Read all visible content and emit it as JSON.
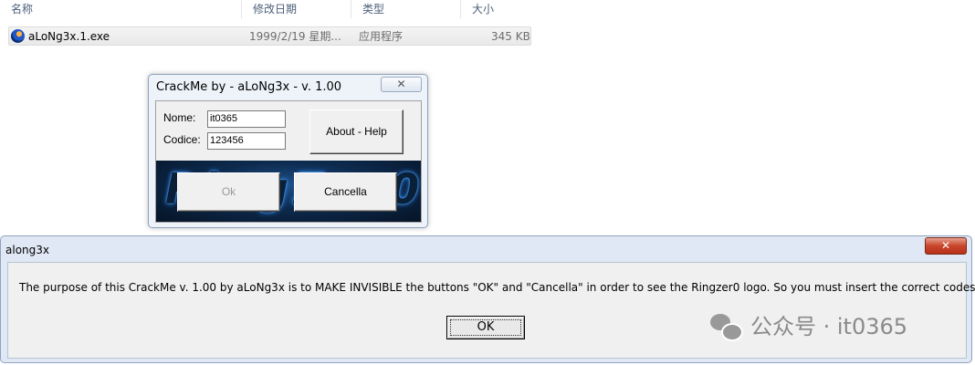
{
  "explorer": {
    "columns": [
      "名称",
      "修改日期",
      "类型",
      "大小"
    ],
    "file": {
      "name": "aLoNg3x.1.exe",
      "date": "1999/2/19 星期...",
      "type": "应用程序",
      "size": "345 KB"
    }
  },
  "crackme": {
    "title": "CrackMe by - aLoNg3x - v. 1.00",
    "close_glyph": "✕",
    "name_label": "Nome:",
    "name_value": "it0365",
    "code_label": "Codice:",
    "code_value": "123456",
    "about_label": "About - Help",
    "ok_label": "Ok",
    "cancel_label": "Cancella",
    "logo_text": "RingZer0"
  },
  "msgbox": {
    "title": "along3x",
    "close_glyph": "✕",
    "message": "The purpose of this CrackMe v. 1.00 by aLoNg3x is to MAKE INVISIBLE the buttons \"OK\" and \"Cancella\" in order to see the Ringzer0 logo. So you must insert the correct codes",
    "ok_label": "OK"
  },
  "watermark": {
    "text": "公众号 · it0365",
    "icon": "wechat-icon"
  }
}
